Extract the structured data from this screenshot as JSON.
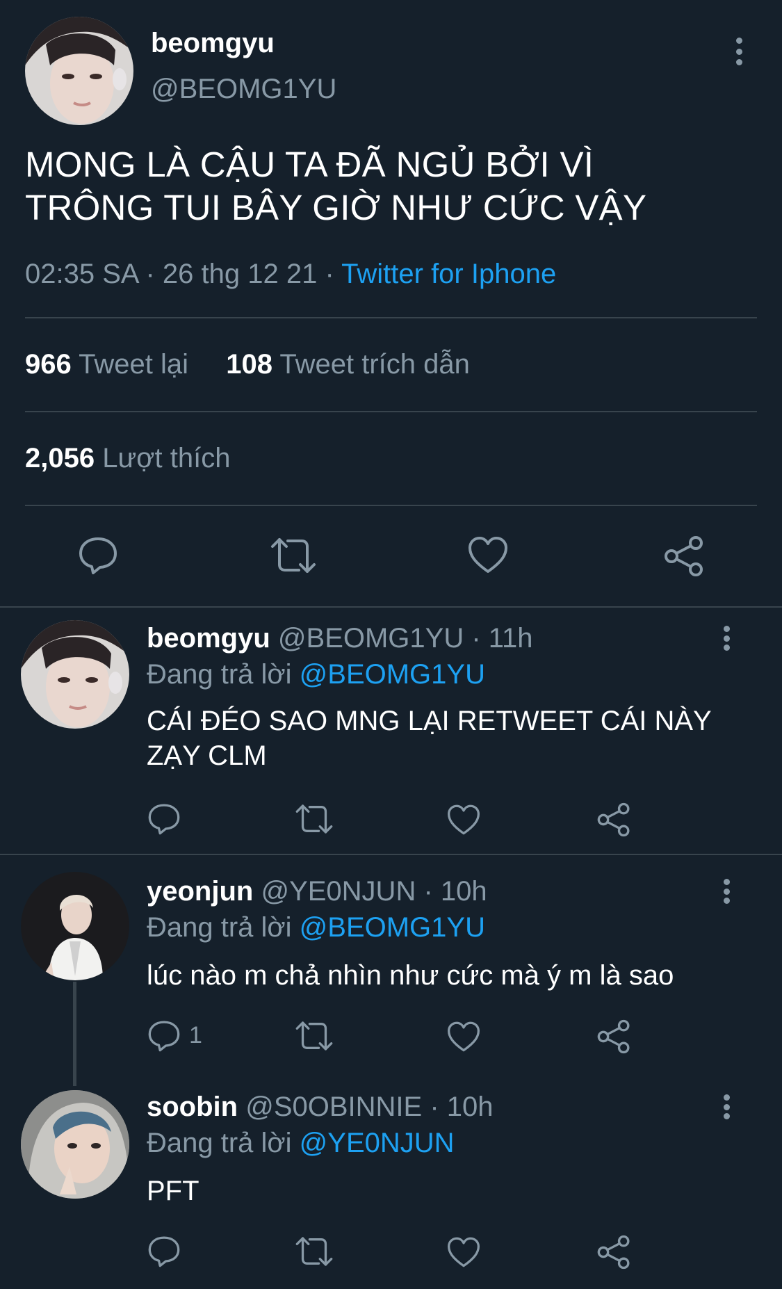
{
  "main_tweet": {
    "name": "beomgyu",
    "handle": "@BEOMG1YU",
    "text_line1": "MONG LÀ CẬU TA ĐÃ NGỦ BỞI VÌ",
    "text_line2": "TRÔNG TUI BÂY GIỜ NHƯ CỨC VẬY",
    "time": "02:35 SA · 26 thg 12 21 · ",
    "source": "Twitter for Iphone",
    "retweets_count": "966",
    "retweets_label": "Tweet lại",
    "quotes_count": "108",
    "quotes_label": "Tweet trích dẫn",
    "likes_count": "2,056",
    "likes_label": "Lượt thích"
  },
  "replies": [
    {
      "name": "beomgyu",
      "handle_time": " @BEOMG1YU · 11h",
      "replying_to_label": "Đang trả lời ",
      "replying_to": "@BEOMG1YU",
      "text_line1": "CÁI ĐÉO SAO MNG LẠI RETWEET CÁI NÀY",
      "text_line2": "ZẠY CLM"
    },
    {
      "name": "yeonjun",
      "handle_time": " @YE0NJUN · 10h",
      "replying_to_label": "Đang trả lời ",
      "replying_to": "@BEOMG1YU",
      "text_line1": "lúc nào m chả nhìn như cức mà ý m là sao",
      "reply_count": "1"
    },
    {
      "name": "soobin",
      "handle_time": " @S0OBINNIE · 10h",
      "replying_to_label": "Đang trả lời ",
      "replying_to": "@YE0NJUN",
      "text_line1": "PFT"
    }
  ],
  "icons": [
    "reply-icon",
    "retweet-icon",
    "like-icon",
    "share-icon",
    "more-icon"
  ],
  "colors": {
    "background": "#15202b",
    "divider": "#38444d",
    "secondary_text": "#8899a6",
    "link": "#1da1f2",
    "primary_text": "#ffffff"
  }
}
